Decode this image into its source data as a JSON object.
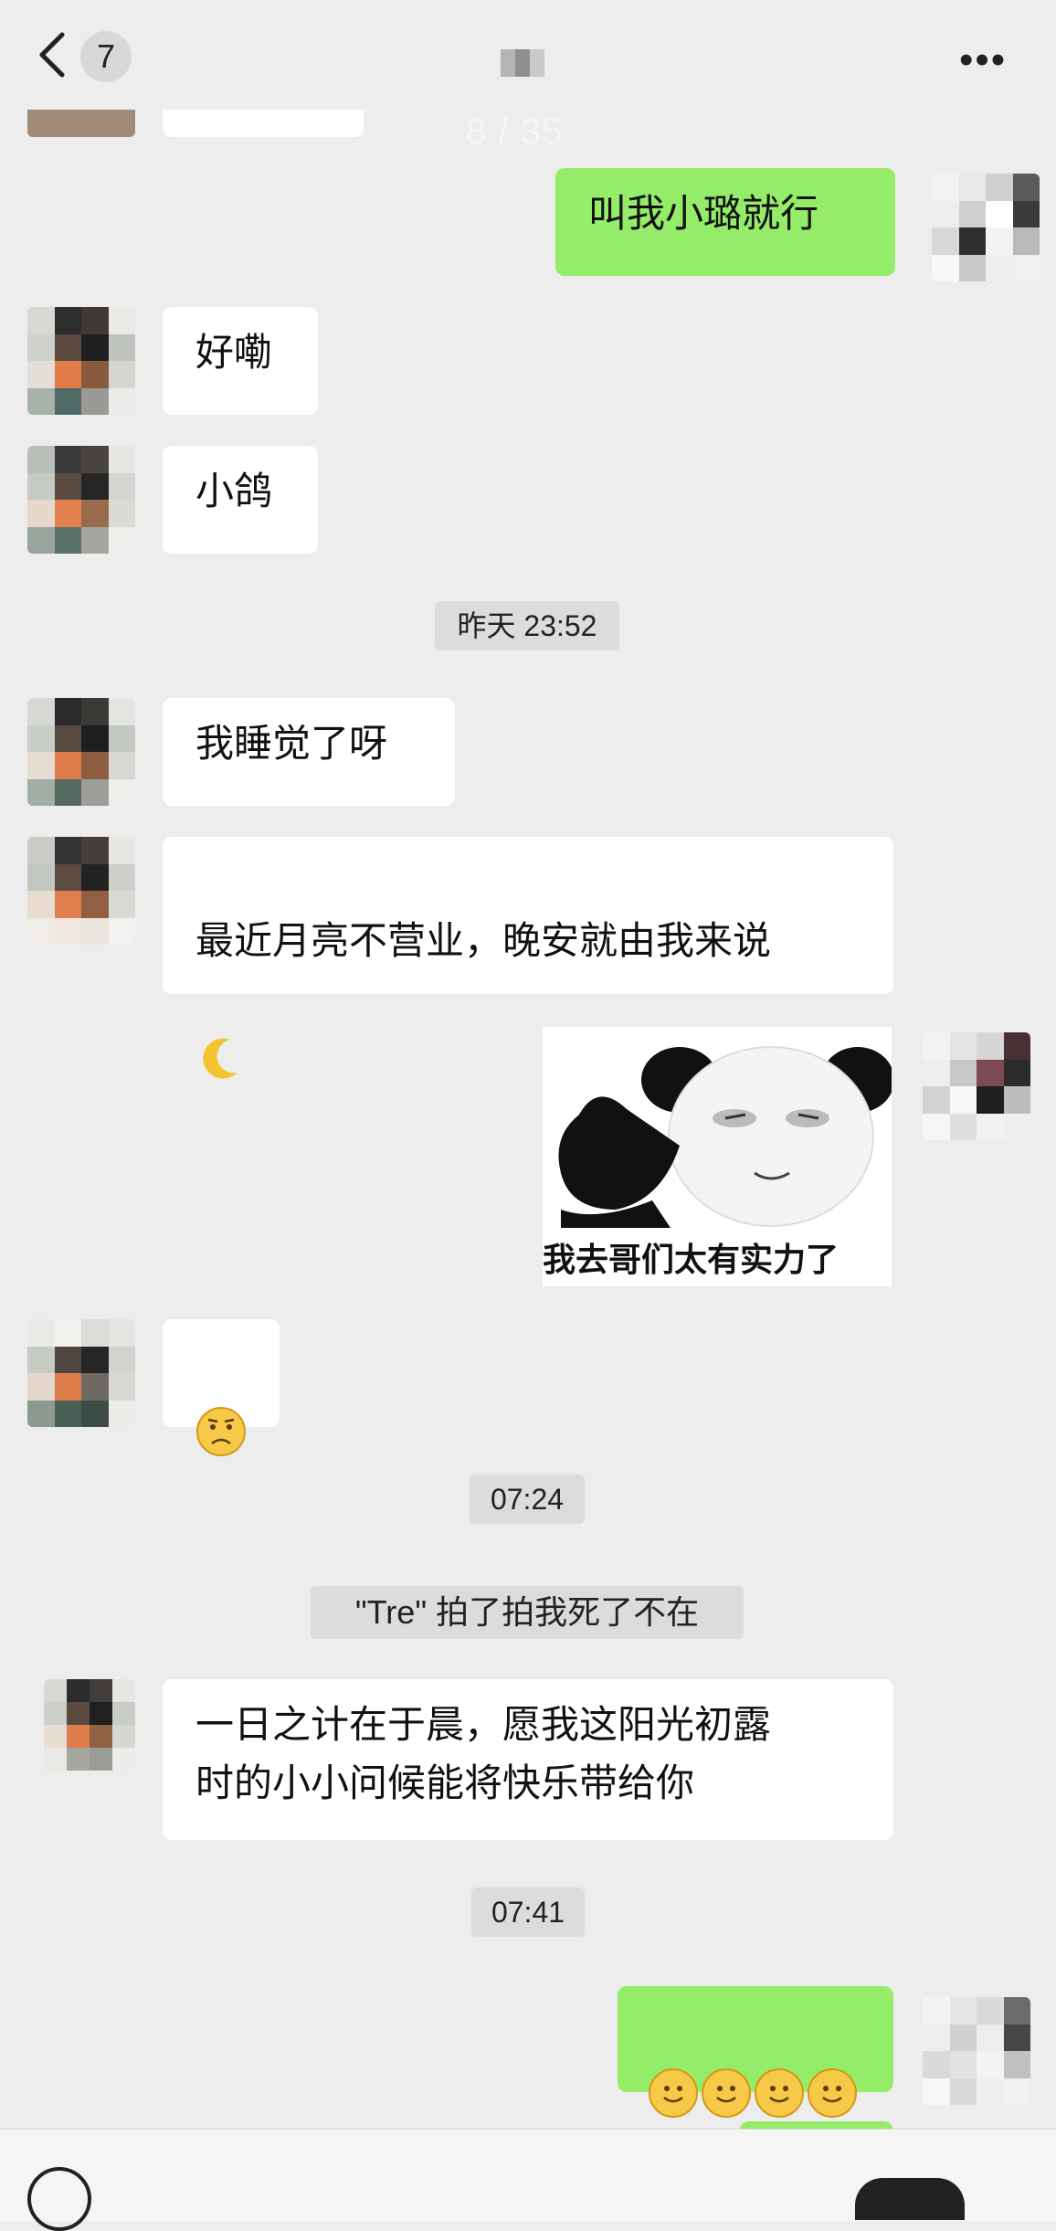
{
  "header": {
    "back_icon": "chevron-left-icon",
    "unread_count": "7",
    "more_icon": "more-dots-icon",
    "pager": "8 / 35"
  },
  "messages": {
    "m1": "叫我小璐就行",
    "m2": "好嘞",
    "m3": "小鸽",
    "t1": "昨天 23:52",
    "m4": "我睡觉了呀",
    "m5": "最近月亮不营业，晚安就由我来说",
    "m5_emoji": "moon-icon",
    "sticker_caption": "我去哥们太有实力了",
    "m6_emoji": "frown-emoji-icon",
    "t2": "07:24",
    "system": "\"Tre\" 拍了拍我死了不在",
    "m7": "一日之计在于晨，愿我这阳光初露\n时的小小问候能将快乐带给你",
    "t3": "07:41",
    "m8_emoji": "smile-emoji-icon ×4"
  },
  "footer": {
    "voice_icon": "voice-icon"
  },
  "colors": {
    "bg": "#ededed",
    "bubble_right": "#95ec69",
    "bubble_left": "#ffffff"
  }
}
